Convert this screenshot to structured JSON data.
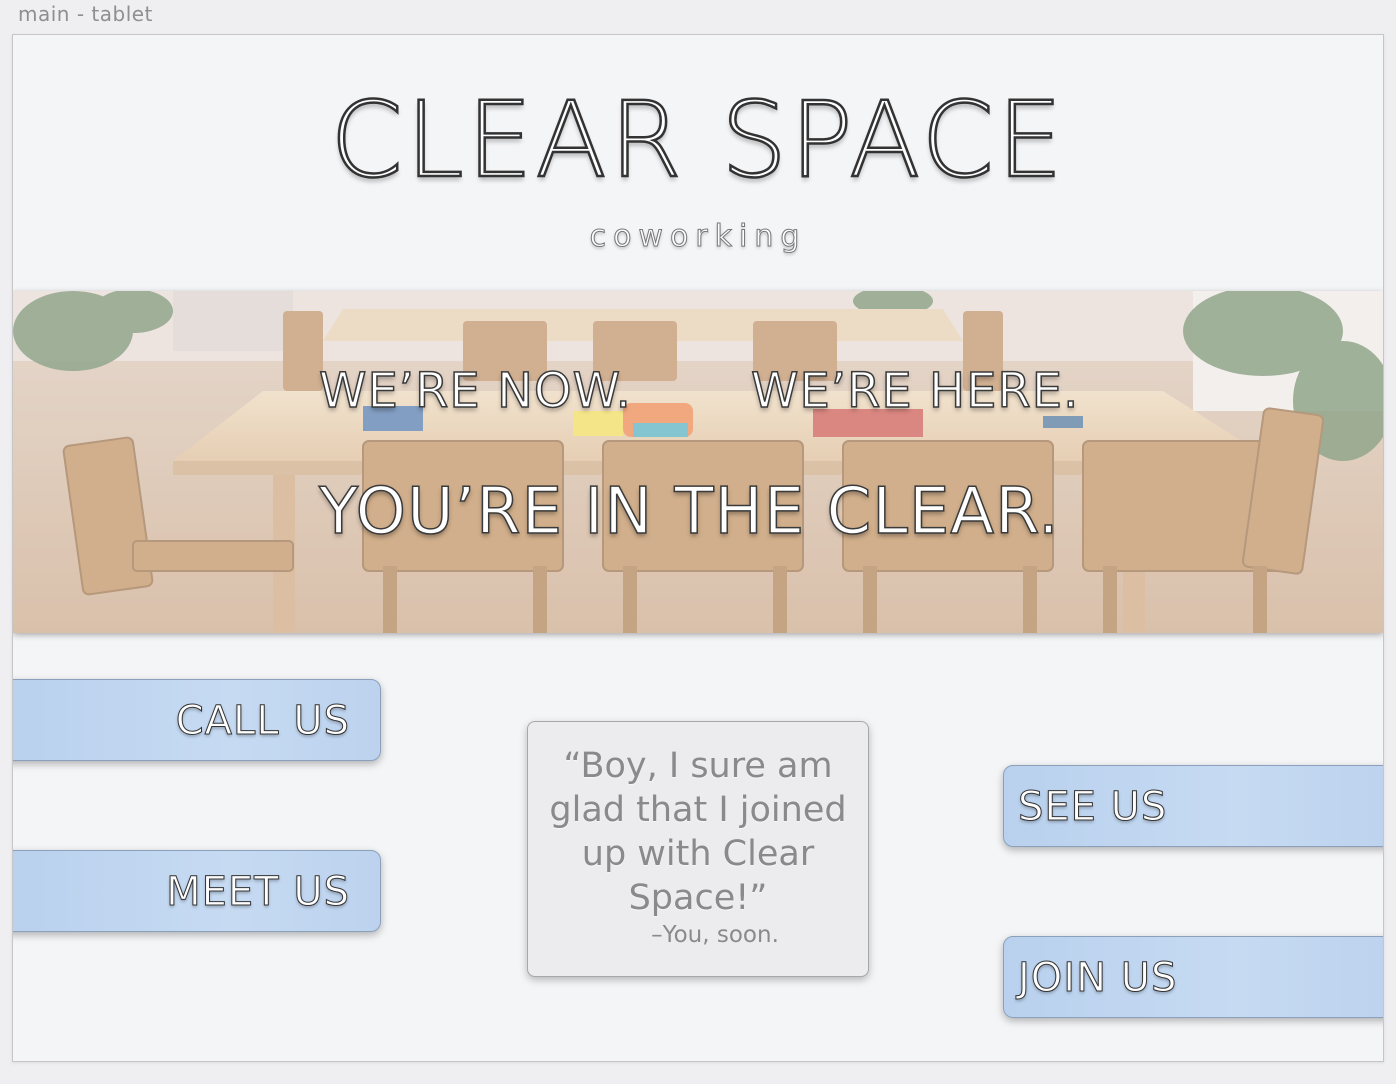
{
  "artboard": {
    "label": "main - tablet"
  },
  "header": {
    "brand": "CLEAR SPACE",
    "tagline": "coworking"
  },
  "hero": {
    "line1a": "WE’RE NOW.",
    "line1b": "WE’RE HERE.",
    "line2": "YOU’RE IN THE CLEAR."
  },
  "actions": {
    "call": "CALL US",
    "meet": "MEET US",
    "see": "SEE US",
    "join": "JOIN US"
  },
  "testimonial": {
    "quote": "“Boy, I sure am glad that I joined up with Clear Space!”",
    "attribution": "–You, soon."
  },
  "colors": {
    "page_bg": "#f4f5f7",
    "button_fill": "#bfd5f0",
    "card_fill": "#ececee"
  }
}
